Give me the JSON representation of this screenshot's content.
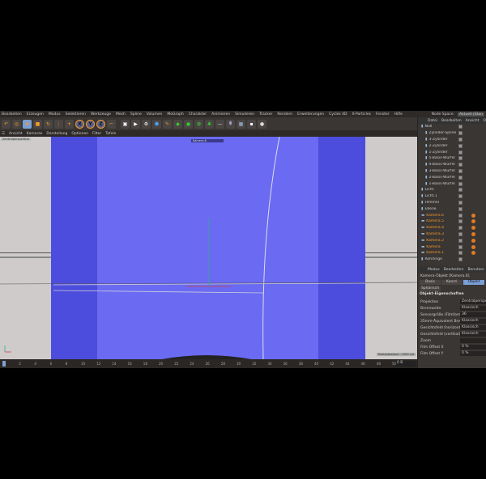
{
  "menu": [
    "Bearbeiten",
    "Erzeugen",
    "Modus",
    "Selektieren",
    "Werkzeuge",
    "Mesh",
    "Spline",
    "Volumen",
    "MoGraph",
    "Charakter",
    "Animieren",
    "Simulieren",
    "Tracker",
    "Rendern",
    "Erweiterungen",
    "Cycles 4D",
    "X-Particles",
    "Fenster",
    "Hilfe"
  ],
  "layout": {
    "label": "Node Space:",
    "value": "Aktuell (Stan"
  },
  "toolbar": {
    "axes": [
      "X",
      "Y",
      "Z"
    ]
  },
  "viewport_menu": [
    "Ansicht",
    "Kameras",
    "Darstellung",
    "Optionen",
    "Filter",
    "Tafeln"
  ],
  "viewport": {
    "camera_dropdown": "Kamera.6",
    "left_label": "Zentralperspektive",
    "grid_info": "Rasterabstand : 1000 cm"
  },
  "timeline": {
    "ticks": [
      "0",
      "2",
      "4",
      "6",
      "8",
      "10",
      "12",
      "14",
      "16",
      "18",
      "20",
      "22",
      "24",
      "26",
      "28",
      "30",
      "32",
      "34",
      "36",
      "38",
      "40",
      "42",
      "44",
      "46",
      "48",
      "50"
    ],
    "frame_field": "0 B"
  },
  "object_manager": {
    "menu": [
      "Datei",
      "Bearbeiten",
      "Ansicht",
      "Objekt"
    ],
    "objects": [
      {
        "name": "Null",
        "indent": 0,
        "camera": false
      },
      {
        "name": "Zylinder-Spline",
        "indent": 1,
        "camera": false
      },
      {
        "name": "3-Zylinder",
        "indent": 1,
        "camera": false
      },
      {
        "name": "2-Zylinder",
        "indent": 1,
        "camera": false
      },
      {
        "name": "1-Zylinder",
        "indent": 1,
        "camera": false
      },
      {
        "name": "5-Basis-Würfel",
        "indent": 1,
        "camera": false
      },
      {
        "name": "4-Basis-Würfel",
        "indent": 1,
        "camera": false
      },
      {
        "name": "3-Basis-Würfel",
        "indent": 1,
        "camera": false
      },
      {
        "name": "2-Basis-Würfel",
        "indent": 1,
        "camera": false
      },
      {
        "name": "1-Basis-Würfel",
        "indent": 1,
        "camera": false
      },
      {
        "name": "Licht",
        "indent": 0,
        "camera": false
      },
      {
        "name": "Licht.1",
        "indent": 0,
        "camera": false
      },
      {
        "name": "Himmel",
        "indent": 0,
        "camera": false
      },
      {
        "name": "Ebene",
        "indent": 0,
        "camera": false
      },
      {
        "name": "Kamera.6",
        "indent": 0,
        "camera": true
      },
      {
        "name": "Kamera.5",
        "indent": 0,
        "camera": true
      },
      {
        "name": "Kamera.4",
        "indent": 0,
        "camera": true
      },
      {
        "name": "Kamera.3",
        "indent": 0,
        "camera": true
      },
      {
        "name": "Kamera.2",
        "indent": 0,
        "camera": true
      },
      {
        "name": "Kamera",
        "indent": 0,
        "camera": true
      },
      {
        "name": "Kamera.1",
        "indent": 0,
        "camera": true
      },
      {
        "name": "Rohrlinge",
        "indent": 0,
        "camera": false
      }
    ]
  },
  "attributes": {
    "menu": [
      "Modus",
      "Bearbeiten",
      "Benutzer"
    ],
    "title": "Kamera-Objekt [Kamera.6]",
    "tabs": [
      "Basis",
      "Koord.",
      "Objekt"
    ],
    "active_tab": "Objekt",
    "tab2": "Sphärisch",
    "section": "Objekt-Eigenschaften",
    "fields": [
      {
        "label": "Projektion",
        "value": "Zentralperspektive"
      },
      {
        "label": "Brennweite",
        "value": "Klassisch"
      },
      {
        "label": "Sensorgröße (Filmformat)",
        "value": "36"
      },
      {
        "label": "35mm-Äquivalent Brennweite",
        "value": "Klassisch"
      },
      {
        "label": "Gesichtsfeld (horizontal)",
        "value": "Klassisch"
      },
      {
        "label": "Gesichtsfeld (vertikal)",
        "value": "Klassisch"
      },
      {
        "label": "Zoom",
        "value": ""
      },
      {
        "label": "Film Offset X",
        "value": "0 %"
      },
      {
        "label": "Film Offset Y",
        "value": "0 %"
      }
    ]
  },
  "colors": {
    "viewport_inner": "#6a6af2",
    "viewport_outer": "#4d4ddd",
    "camera_name": "#f39a2b",
    "accent": "#7a9fd6"
  }
}
